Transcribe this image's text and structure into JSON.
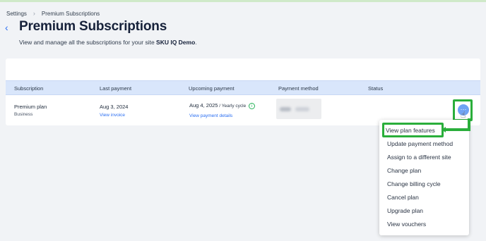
{
  "breadcrumb": {
    "items": [
      "Settings",
      "Premium Subscriptions"
    ],
    "separator": "›"
  },
  "header": {
    "back_glyph": "‹",
    "title": "Premium Subscriptions",
    "subtitle_prefix": "View and manage all the subscriptions for your site ",
    "site_name": "SKU IQ Demo",
    "subtitle_suffix": "."
  },
  "table": {
    "columns": [
      "Subscription",
      "Last payment",
      "Upcoming payment",
      "Payment method",
      "Status"
    ],
    "row": {
      "plan_name": "Premium plan",
      "plan_tier": "Business",
      "last_payment_date": "Aug 3, 2024",
      "last_payment_link": "View invoice",
      "upcoming_date": "Aug 4, 2025",
      "upcoming_separator": " / ",
      "upcoming_cycle": "Yearly cycle",
      "upcoming_link": "View payment details",
      "more_glyph": "···"
    }
  },
  "menu": {
    "items": [
      "View plan features",
      "Update payment method",
      "Assign to a different site",
      "Change plan",
      "Change billing cycle",
      "Cancel plan",
      "Upgrade plan",
      "View vouchers"
    ]
  },
  "icons": {
    "info": "i",
    "cursor": "☝"
  },
  "colors": {
    "accent": "#2b6ff2",
    "header_row": "#d9e6fb",
    "highlight": "#2aae3b",
    "background": "#f1f3f6"
  }
}
